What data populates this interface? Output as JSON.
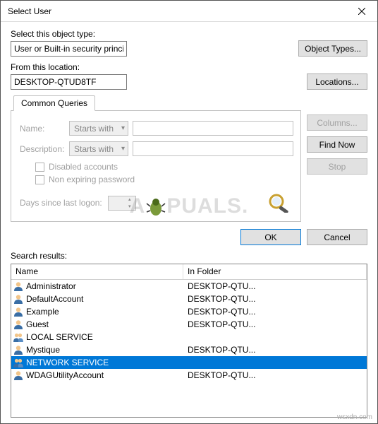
{
  "window": {
    "title": "Select User"
  },
  "objectType": {
    "label": "Select this object type:",
    "value": "User or Built-in security principal",
    "button": "Object Types..."
  },
  "location": {
    "label": "From this location:",
    "value": "DESKTOP-QTUD8TF",
    "button": "Locations..."
  },
  "commonQueries": {
    "tab": "Common Queries",
    "nameLabel": "Name:",
    "nameMode": "Starts with",
    "descLabel": "Description:",
    "descMode": "Starts with",
    "disabled": "Disabled accounts",
    "nonExpiring": "Non expiring password",
    "daysLabel": "Days since last logon:"
  },
  "sideButtons": {
    "columns": "Columns...",
    "findNow": "Find Now",
    "stop": "Stop"
  },
  "okCancel": {
    "ok": "OK",
    "cancel": "Cancel"
  },
  "searchResults": {
    "label": "Search results:",
    "columns": {
      "name": "Name",
      "folder": "In Folder"
    },
    "rows": [
      {
        "icon": "user",
        "name": "Administrator",
        "folder": "DESKTOP-QTU...",
        "selected": false
      },
      {
        "icon": "user",
        "name": "DefaultAccount",
        "folder": "DESKTOP-QTU...",
        "selected": false
      },
      {
        "icon": "user",
        "name": "Example",
        "folder": "DESKTOP-QTU...",
        "selected": false
      },
      {
        "icon": "user",
        "name": "Guest",
        "folder": "DESKTOP-QTU...",
        "selected": false
      },
      {
        "icon": "group",
        "name": "LOCAL SERVICE",
        "folder": "",
        "selected": false
      },
      {
        "icon": "user",
        "name": "Mystique",
        "folder": "DESKTOP-QTU...",
        "selected": false
      },
      {
        "icon": "group",
        "name": "NETWORK SERVICE",
        "folder": "",
        "selected": true
      },
      {
        "icon": "user",
        "name": "WDAGUtilityAccount",
        "folder": "DESKTOP-QTU...",
        "selected": false
      }
    ]
  },
  "watermark": {
    "brand_left": "A",
    "brand_right": "PUALS."
  },
  "footer": {
    "host": "wsxdn.com"
  }
}
